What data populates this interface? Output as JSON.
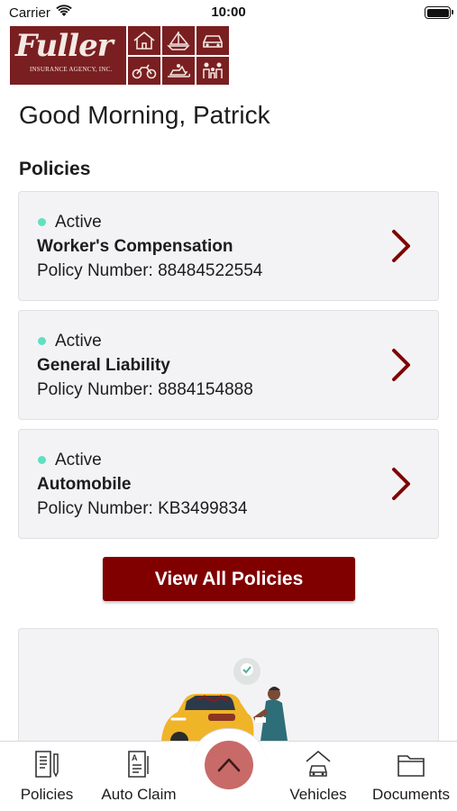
{
  "status_bar": {
    "carrier": "Carrier",
    "time": "10:00"
  },
  "logo": {
    "wordmark": "Fuller",
    "tagline": "INSURANCE AGENCY, INC.",
    "icons": [
      "house-icon",
      "sailboat-icon",
      "car-icon",
      "motorcycle-icon",
      "snowmobile-icon",
      "family-icon"
    ],
    "brand_color": "#7a1f21"
  },
  "greeting": "Good Morning, Patrick",
  "policies_section": {
    "title": "Policies",
    "items": [
      {
        "status": "Active",
        "name": "Worker's Compensation",
        "number": "Policy Number: 88484522554"
      },
      {
        "status": "Active",
        "name": "General Liability",
        "number": "Policy Number: 8884154888"
      },
      {
        "status": "Active",
        "name": "Automobile",
        "number": "Policy Number: KB3499834"
      }
    ],
    "status_color": "#5fe0c1",
    "view_all_label": "View All Policies"
  },
  "promo": {
    "illustration": "car-repair-illustration"
  },
  "tab_bar": {
    "tabs": [
      {
        "label": "Policies",
        "icon": "policies-document-icon"
      },
      {
        "label": "Auto Claim",
        "icon": "auto-claim-icon"
      },
      {
        "label": "Vehicles",
        "icon": "vehicle-garage-icon"
      },
      {
        "label": "Documents",
        "icon": "folder-icon"
      }
    ],
    "center_button_icon": "chevron-up-icon"
  },
  "colors": {
    "accent": "#800000",
    "fab": "#c86a68",
    "card_bg": "#f3f3f5"
  }
}
